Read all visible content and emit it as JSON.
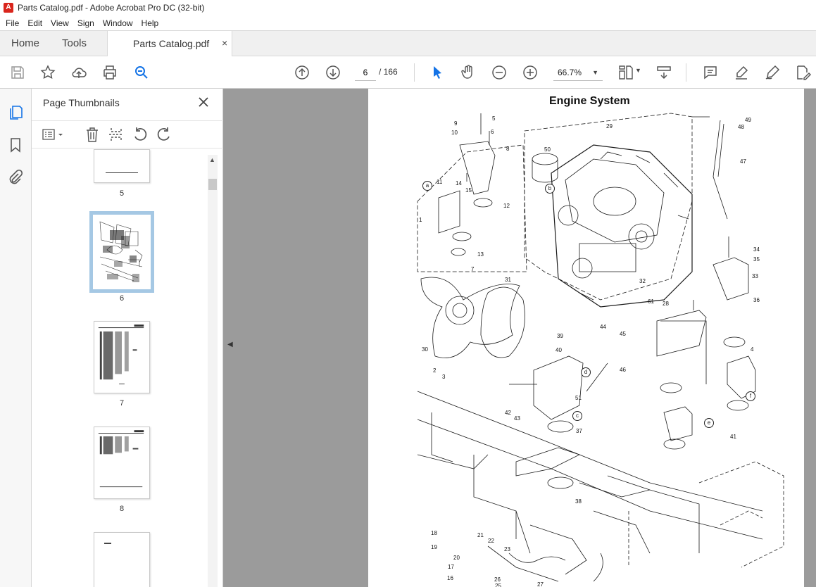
{
  "window": {
    "title": "Parts Catalog.pdf - Adobe Acrobat Pro DC (32-bit)"
  },
  "menu": [
    "File",
    "Edit",
    "View",
    "Sign",
    "Window",
    "Help"
  ],
  "tabs": {
    "home": "Home",
    "tools": "Tools",
    "document": "Parts Catalog.pdf",
    "close": "×"
  },
  "toolbar": {
    "current_page": "6",
    "total_pages": "/ 166",
    "zoom": "66.7%",
    "icons": [
      "save-icon",
      "bookmark-star-icon",
      "upload-icon",
      "print-icon",
      "find-zoom-icon",
      "prev-page-icon",
      "next-page-icon",
      "select-cursor-icon",
      "hand-icon",
      "zoom-out-icon",
      "zoom-in-icon",
      "page-fit-icon",
      "scroll-mode-icon",
      "comment-icon",
      "highlight-icon",
      "sign-icon",
      "edit-pdf-icon"
    ]
  },
  "panel": {
    "title": "Page Thumbnails",
    "thumbnails": [
      {
        "label": "5"
      },
      {
        "label": "6",
        "selected": true
      },
      {
        "label": "7"
      },
      {
        "label": "8"
      }
    ]
  },
  "page": {
    "title": "Engine System",
    "callouts": [
      "1",
      "2",
      "3",
      "4",
      "5",
      "6",
      "7",
      "8",
      "9",
      "10",
      "11",
      "12",
      "13",
      "14",
      "15",
      "16",
      "17",
      "18",
      "19",
      "20",
      "21",
      "22",
      "23",
      "25",
      "26",
      "27",
      "28",
      "29",
      "30",
      "31",
      "32",
      "33",
      "34",
      "35",
      "36",
      "37",
      "38",
      "39",
      "40",
      "41",
      "42",
      "43",
      "44",
      "45",
      "46",
      "47",
      "48",
      "49",
      "50",
      "51",
      "61"
    ],
    "circled_refs": [
      "a",
      "b",
      "c",
      "d",
      "e",
      "f"
    ]
  },
  "colors": {
    "accent": "#1473e6",
    "pdf_red": "#d9251c",
    "selection": "#a5c8e4"
  }
}
